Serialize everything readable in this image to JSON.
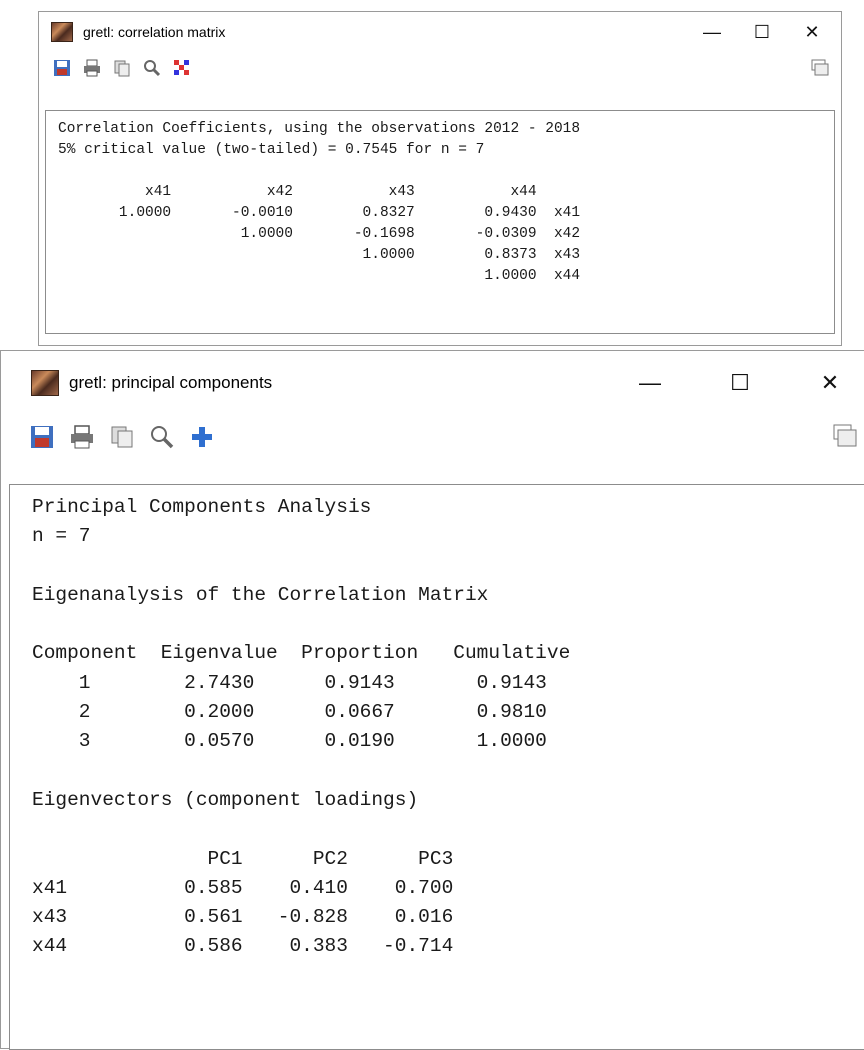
{
  "correlation_window": {
    "title": "gretl: correlation matrix",
    "controls": {
      "minimize": "—",
      "maximize": "☐",
      "close": "✕"
    },
    "toolbar_icons": [
      "save-icon",
      "print-icon",
      "copy-icon",
      "zoom-icon",
      "heatmap-icon"
    ],
    "lines": [
      "Correlation Coefficients, using the observations 2012 - 2018",
      "5% critical value (two-tailed) = 0.7545 for n = 7",
      "",
      "          x41           x42           x43           x44",
      "       1.0000       -0.0010        0.8327        0.9430  x41",
      "                     1.0000       -0.1698       -0.0309  x42",
      "                                   1.0000        0.8373  x43",
      "                                                 1.0000  x44"
    ]
  },
  "pca_window": {
    "title": "gretl: principal components",
    "controls": {
      "minimize": "—",
      "maximize": "☐",
      "close": "✕"
    },
    "toolbar_icons": [
      "save-icon",
      "print-icon",
      "copy-icon",
      "zoom-icon",
      "add-icon"
    ],
    "lines": [
      "Principal Components Analysis",
      "n = 7",
      "",
      "Eigenanalysis of the Correlation Matrix",
      "",
      "Component  Eigenvalue  Proportion   Cumulative",
      "    1        2.7430      0.9143       0.9143",
      "    2        0.2000      0.0667       0.9810",
      "    3        0.0570      0.0190       1.0000",
      "",
      "Eigenvectors (component loadings)",
      "",
      "               PC1      PC2      PC3",
      "x41          0.585    0.410    0.700",
      "x43          0.561   -0.828    0.016",
      "x44          0.586    0.383   -0.714"
    ]
  }
}
